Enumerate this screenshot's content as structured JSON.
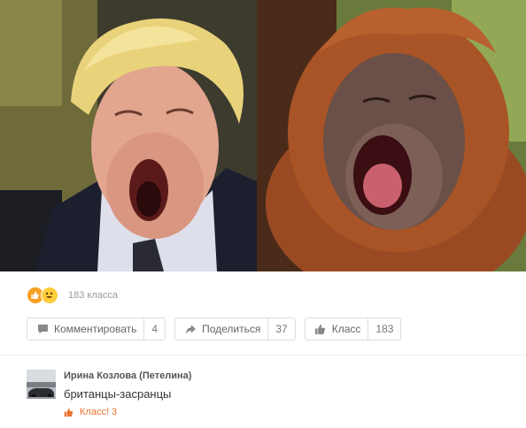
{
  "photo": {
    "alt": ""
  },
  "reactions": {
    "count_text": "183 класса"
  },
  "actions": {
    "comment": {
      "label": "Комментировать",
      "count": "4"
    },
    "share": {
      "label": "Поделиться",
      "count": "37"
    },
    "like": {
      "label": "Класс",
      "count": "183"
    }
  },
  "comment": {
    "author": "Ирина Козлова (Петелина)",
    "text": "британцы-засранцы",
    "like_label": "Класс! 3"
  },
  "colors": {
    "accent": "#eb722e",
    "reaction_like": "#f7a023",
    "reaction_smile": "#ffcc3d"
  },
  "icons": [
    "like-reaction-icon",
    "smile-reaction-icon",
    "comment-icon",
    "share-icon",
    "thumbs-up-icon"
  ]
}
